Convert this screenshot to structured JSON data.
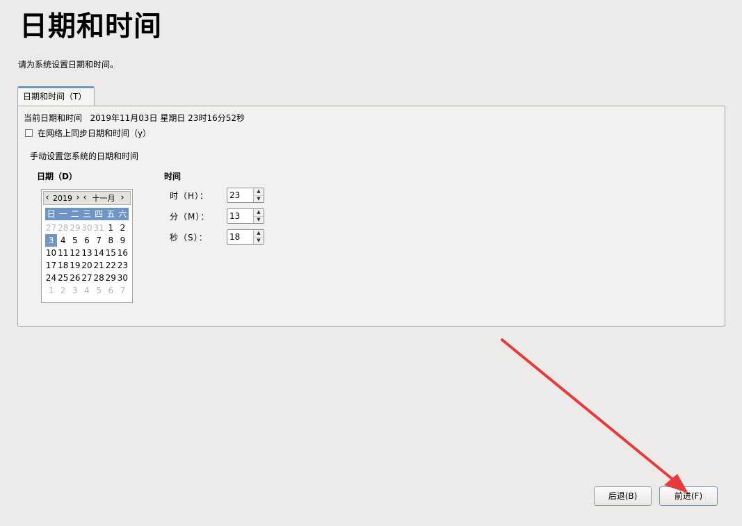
{
  "page": {
    "title": "日期和时间",
    "subtitle": "请为系统设置日期和时间。"
  },
  "tab": {
    "label": "日期和时间（T）"
  },
  "panel": {
    "current_label": "当前日期和时间",
    "current_value": "2019年11月03日  星期日  23时16分52秒",
    "sync_label": "在网络上同步日期和时间（y）",
    "sync_checked": false,
    "manual_heading": "手动设置您系统的日期和时间"
  },
  "date": {
    "label": "日期（D）",
    "calendar": {
      "year": "2019",
      "month": "十一月",
      "weekdays": [
        "日",
        "一",
        "二",
        "三",
        "四",
        "五",
        "六"
      ],
      "rows": [
        [
          "27",
          "28",
          "29",
          "30",
          "31",
          "1",
          "2"
        ],
        [
          "3",
          "4",
          "5",
          "6",
          "7",
          "8",
          "9"
        ],
        [
          "10",
          "11",
          "12",
          "13",
          "14",
          "15",
          "16"
        ],
        [
          "17",
          "18",
          "19",
          "20",
          "21",
          "22",
          "23"
        ],
        [
          "24",
          "25",
          "26",
          "27",
          "28",
          "29",
          "30"
        ],
        [
          "1",
          "2",
          "3",
          "4",
          "5",
          "6",
          "7"
        ]
      ],
      "selected_day": "3",
      "highlight_color": "#6f95c4"
    }
  },
  "time": {
    "label": "时间",
    "hour_label": "时（H）：",
    "hour_value": "23",
    "minute_label": "分（M）：",
    "minute_value": "13",
    "second_label": "秒（S）：",
    "second_value": "18"
  },
  "buttons": {
    "back": "后退(B)",
    "next": "前进(F)"
  },
  "annotation": {
    "arrow_color": "#e83a3a"
  }
}
